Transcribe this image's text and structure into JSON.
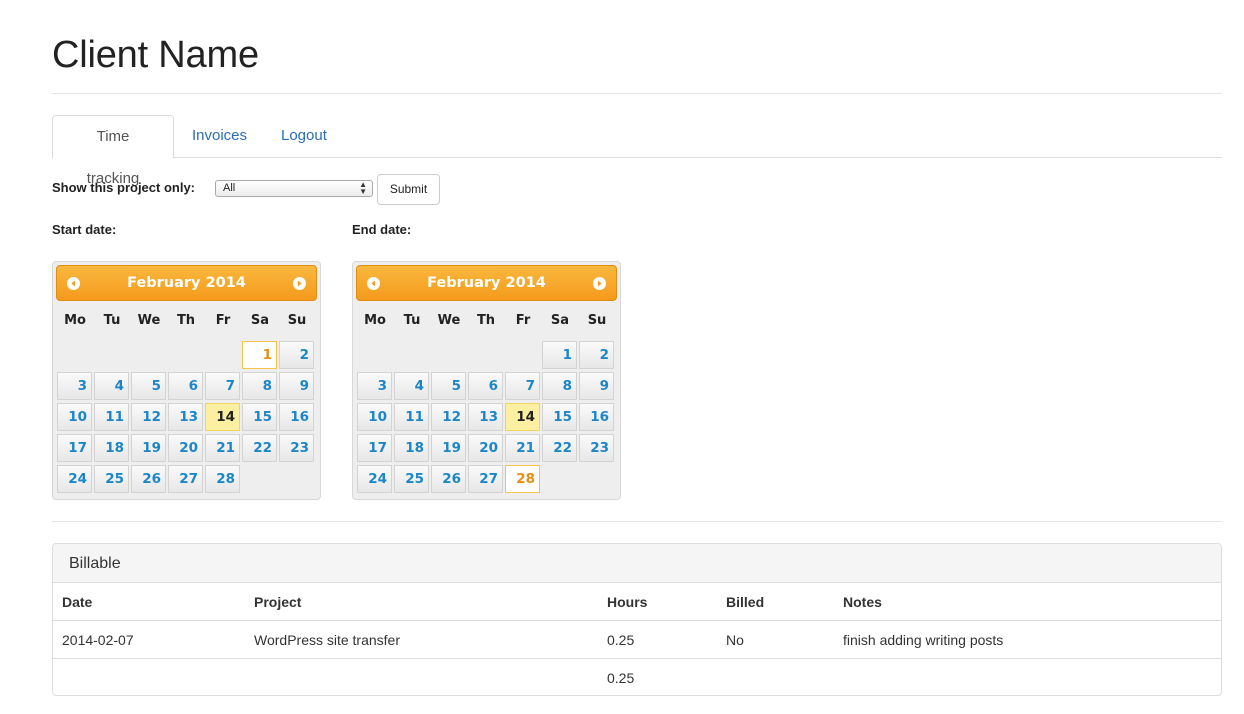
{
  "page": {
    "title": "Client Name"
  },
  "tabs": [
    {
      "label": "Time tracking",
      "active": true
    },
    {
      "label": "Invoices",
      "active": false
    },
    {
      "label": "Logout",
      "active": false
    }
  ],
  "filter": {
    "label": "Show this project only:",
    "selected": "All",
    "submit_label": "Submit"
  },
  "start_date": {
    "label": "Start date:",
    "calendar": {
      "month_label": "February 2014",
      "weekdays": [
        "Mo",
        "Tu",
        "We",
        "Th",
        "Fr",
        "Sa",
        "Su"
      ],
      "first_weekday_index": 5,
      "days_in_month": 28,
      "today": 14,
      "selected": 1
    }
  },
  "end_date": {
    "label": "End date:",
    "calendar": {
      "month_label": "February 2014",
      "weekdays": [
        "Mo",
        "Tu",
        "We",
        "Th",
        "Fr",
        "Sa",
        "Su"
      ],
      "first_weekday_index": 5,
      "days_in_month": 28,
      "today": 14,
      "selected": 28
    }
  },
  "billable": {
    "heading": "Billable",
    "columns": [
      "Date",
      "Project",
      "Hours",
      "Billed",
      "Notes"
    ],
    "rows": [
      [
        "2014-02-07",
        "WordPress site transfer",
        "0.25",
        "No",
        "finish adding writing posts"
      ]
    ],
    "total_hours": "0.25"
  },
  "colors": {
    "header_orange": "#f49a1c",
    "day_blue": "#1c86c7",
    "selected_orange": "#e68f12",
    "today_yellow": "#fcefa1",
    "link_blue": "#2a6fb5"
  }
}
